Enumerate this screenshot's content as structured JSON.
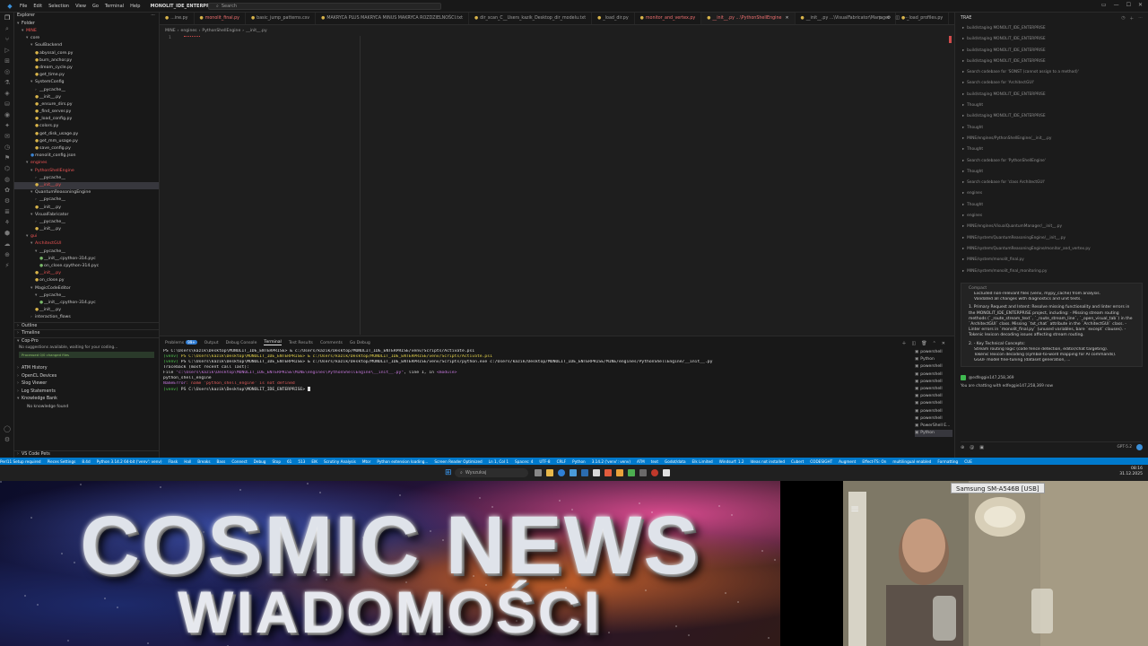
{
  "titlebar": {
    "menus": [
      "File",
      "Edit",
      "Selection",
      "View",
      "Go",
      "Terminal",
      "Help"
    ],
    "workspace": "MONOLIT_IDE_ENTERPRISE",
    "search_placeholder": "Search"
  },
  "explorer": {
    "title": "Explorer",
    "folder_label": "Folder",
    "items": [
      {
        "label": "MINE",
        "indent": 1,
        "chev": "▾",
        "red": true
      },
      {
        "label": "core",
        "indent": 2,
        "chev": "▾"
      },
      {
        "label": "SoulBackend",
        "indent": 3,
        "chev": "▾"
      },
      {
        "label": "abyssal_core.py",
        "indent": 4,
        "icon": "y"
      },
      {
        "label": "burn_anchor.py",
        "indent": 4,
        "icon": "y"
      },
      {
        "label": "dream_cycle.py",
        "indent": 4,
        "icon": "y"
      },
      {
        "label": "get_time.py",
        "indent": 4,
        "icon": "y"
      },
      {
        "label": "SystemConfig",
        "indent": 3,
        "chev": "▾"
      },
      {
        "label": "__pycache__",
        "indent": 4,
        "chev": "›"
      },
      {
        "label": "__init__.py",
        "indent": 4,
        "icon": "y"
      },
      {
        "label": "_ensure_dirs.py",
        "indent": 4,
        "icon": "y"
      },
      {
        "label": "_find_server.py",
        "indent": 4,
        "icon": "y"
      },
      {
        "label": "_load_config.py",
        "indent": 4,
        "icon": "y"
      },
      {
        "label": "colors.py",
        "indent": 4,
        "icon": "y"
      },
      {
        "label": "get_disk_usage.py",
        "indent": 4,
        "icon": "y"
      },
      {
        "label": "get_mm_usage.py",
        "indent": 4,
        "icon": "y"
      },
      {
        "label": "save_config.py",
        "indent": 4,
        "icon": "y"
      },
      {
        "label": "monolit_config.json",
        "indent": 3,
        "icon": "b"
      },
      {
        "label": "engines",
        "indent": 2,
        "chev": "▾",
        "red": true
      },
      {
        "label": "PythonShellEngine",
        "indent": 3,
        "chev": "▾",
        "red": true
      },
      {
        "label": "__pycache__",
        "indent": 4,
        "chev": "›"
      },
      {
        "label": "__init__.py",
        "indent": 4,
        "icon": "y",
        "red": true,
        "selected": true
      },
      {
        "label": "QuantumReasoningEngine",
        "indent": 3,
        "chev": "▾"
      },
      {
        "label": "__pycache__",
        "indent": 4,
        "chev": "›"
      },
      {
        "label": "__init__.py",
        "indent": 4,
        "icon": "y"
      },
      {
        "label": "VisualFabricator",
        "indent": 3,
        "chev": "▾"
      },
      {
        "label": "__pycache__",
        "indent": 4,
        "chev": "›"
      },
      {
        "label": "__init__.py",
        "indent": 4,
        "icon": "y"
      },
      {
        "label": "gui",
        "indent": 2,
        "chev": "▾",
        "red": true
      },
      {
        "label": "ArchitectGUI",
        "indent": 3,
        "chev": "▾",
        "red": true
      },
      {
        "label": "__pycache__",
        "indent": 4,
        "chev": "▾"
      },
      {
        "label": "__init__.cpython-314.pyc",
        "indent": 5,
        "icon": "g"
      },
      {
        "label": "on_close.cpython-314.pyc",
        "indent": 5,
        "icon": "g"
      },
      {
        "label": "__init__.py",
        "indent": 4,
        "icon": "y",
        "red": true
      },
      {
        "label": "on_close.py",
        "indent": 4,
        "icon": "y"
      },
      {
        "label": "MagicCodeEditor",
        "indent": 3,
        "chev": "▾"
      },
      {
        "label": "__pycache__",
        "indent": 4,
        "chev": "▾"
      },
      {
        "label": "__init__.cpython-314.pyc",
        "indent": 5,
        "icon": "g"
      },
      {
        "label": "__init__.py",
        "indent": 4,
        "icon": "y"
      },
      {
        "label": "interaction_flows",
        "indent": 3,
        "chev": "›"
      }
    ],
    "sections_top": [
      "Outline",
      "Timeline"
    ],
    "codepro": {
      "title": "Cop-Pro",
      "line1": "No suggestions available, waiting for your coding...",
      "line2": "Processed 0/0 changed files"
    },
    "sections_bottom": [
      "ATM History",
      "OpenCL Devices",
      "Slog Viewer",
      "Log Statements",
      "Knowledge Bank"
    ],
    "knowledge_empty": "No knowledge found",
    "footer": "VS Code Pets"
  },
  "tabs": [
    {
      "label": "...ine.py",
      "state": ""
    },
    {
      "label": "monolit_final.py",
      "state": "err"
    },
    {
      "label": "basic_jump_patterns.csv",
      "state": ""
    },
    {
      "label": "MAKRYCA PLUS MAKRYCA MINUS MAKRYCA ROZDZIELNOŚCI.txt",
      "state": ""
    },
    {
      "label": "dir_scan_C__Users_kazik_Desktop_dir_modelu.txt",
      "state": ""
    },
    {
      "label": "_load_dir.py",
      "state": ""
    },
    {
      "label": "monitor_and_vertex.py",
      "state": "err"
    },
    {
      "label": "__init__.py ...\\PythonShellEngine",
      "state": "active"
    },
    {
      "label": "__init__.py ...\\VisualFabricator\\Manager",
      "state": ""
    },
    {
      "label": "_load_profiles.py",
      "state": ""
    }
  ],
  "breadcrumb": [
    "MINE",
    "engines",
    "PythonShellEngine",
    "__init__.py"
  ],
  "editor": {
    "line_number": "1"
  },
  "panel": {
    "tabs": [
      "Problems",
      "Output",
      "Debug Console",
      "Terminal",
      "Test Results",
      "Comments",
      "Go Debug"
    ],
    "problems_count": "99+",
    "active_tab": "Terminal",
    "terminal_lines": [
      [
        {
          "t": "PS C:\\Users\\kazik\\Desktop\\MONOLIT_IDE_ENTERPRISE> & c:/Users/kazik/Desktop/MONOLIT_IDE_ENTERPRISE/venv/Scripts/Activate.ps1",
          "c": "c-white"
        }
      ],
      [
        {
          "t": "(venv) ",
          "c": "c-green"
        },
        {
          "t": "PS C:\\Users\\kazik\\Desktop\\MONOLIT_IDE_ENTERPRISE> & c:/Users/kazik/Desktop/MONOLIT_IDE_ENTERPRISE/venv/Scripts/Activate.ps1",
          "c": "c-yellow"
        }
      ],
      [
        {
          "t": "(venv) ",
          "c": "c-green"
        },
        {
          "t": "PS C:\\Users\\kazik\\Desktop\\MONOLIT_IDE_ENTERPRISE> & c:/Users/kazik/Desktop/MONOLIT_IDE_ENTERPRISE/venv/Scripts/python.exe c:/Users/kazik/Desktop/MONOLIT_IDE_ENTERPRISE/MINE/engines/PythonShellEngine/__init__.py",
          "c": "c-white"
        }
      ],
      [
        {
          "t": "Traceback (most recent call last):",
          "c": "c-white"
        }
      ],
      [
        {
          "t": "  File ",
          "c": "c-white"
        },
        {
          "t": "\"c:\\Users\\kazik\\Desktop\\MONOLIT_IDE_ENTERPRISE\\MINE\\engines\\PythonShellEngine\\__init__.py\"",
          "c": "c-mag"
        },
        {
          "t": ", line 1, in ",
          "c": "c-white"
        },
        {
          "t": "<module>",
          "c": "c-mag"
        }
      ],
      [
        {
          "t": "    python_shell_engine",
          "c": "c-white"
        }
      ],
      [
        {
          "t": "NameError",
          "c": "c-mag"
        },
        {
          "t": ": name 'python_shell_engine' is not defined",
          "c": "c-red"
        }
      ],
      [
        {
          "t": "(venv) ",
          "c": "c-green"
        },
        {
          "t": "PS C:\\Users\\kazik\\Desktop\\MONOLIT_IDE_ENTERPRISE> ",
          "c": "c-white"
        }
      ]
    ],
    "terminal_list": [
      "powershell",
      "Python",
      "powershell",
      "powershell",
      "powershell",
      "powershell",
      "powershell",
      "powershell",
      "powershell",
      "powershell",
      "PowerShell E...",
      "Python"
    ]
  },
  "copilot": {
    "title": "TRAE",
    "history": [
      "build/staging MONOLIT_IDE_ENTERPRISE",
      "build/staging MONOLIT_IDE_ENTERPRISE",
      "build/staging MONOLIT_IDE_ENTERPRISE",
      "build/staging MONOLIT_IDE_ENTERPRISE",
      "Search codebase for 'SONST (cannot assign to a method)'",
      "Search codebase for 'ArchitectGUI'",
      "build/staging MONOLIT_IDE_ENTERPRISE",
      "Thought",
      "build/staging MONOLIT_IDE_ENTERPRISE",
      "Thought",
      "MINE/engines/PythonShellEngine/__init__.py",
      "Thought",
      "Search codebase for 'PythonShellEngine'",
      "Thought",
      "Search codebase for 'class ArchitectGUI'",
      "engines",
      "Thought",
      "engines",
      "MINE/engines/VisualQuantumManager/__init__.py",
      "MINE/system/QuantumReasoningEngine/__init__.py",
      "MINE/system/QuantumReasoningEngine/monitor_and_vertex.py",
      "MINE/system/monolit_final.py",
      "MINE/system/monolit_final_monitoring.py"
    ],
    "summary_head": "Compact",
    "summary_bullets": [
      "Excluded non-relevant files (venv, mypy_cache) from analysis.",
      "Validated all changes with diagnostics and unit tests."
    ],
    "para1": "1. Primary Request and Intent: Resolve missing functionality and linter errors in the MONOLIT_IDE_ENTERPRISE project, including: - Missing stream routing methods (`_route_stream_text`, `_route_stream_line`, `_open_visual_tab`) in the `ArchitectGUI` class. Missing `txt_chat` attribute in the `ArchitectGUI` class. - Linter errors in `monolit_final.py` (unused variables, bare `except` clauses). - Tokenic lexicon decoding issues affecting stream routing.",
    "para2": "2. - Key Technical Concepts:",
    "bullets2": [
      "Stream routing logic (code fence detection, editor/chat targeting).",
      "Tokenic lexicon decoding (symbol-to-word mapping for AI commands).",
      "GGUF model fine-tuning (dataset generation, ..."
    ],
    "user": "@edfeggie147,258,369",
    "chat_line": "You are chatting with edfeggie147,258,369 now",
    "model": "GPT-5.2"
  },
  "statusbar": [
    "Perl11 Setup required",
    "Pieces Settings",
    "8.4d",
    "Python 3.14.2 64-bit ('venv': venv)",
    "Flask",
    "Hall",
    "Breaks",
    "Bass",
    "Connect",
    "Debug",
    "Stop",
    "61",
    "513",
    "EIK",
    "Scrutiny Analysis",
    "Mtor",
    "Python extension loading...",
    "Screen Reader Optimized",
    "Ln 1, Col 1",
    "Spaces: 4",
    "UTF-8",
    "CRLF",
    "Python",
    "3.14.2 ('venv': venv)",
    "ATM",
    "text",
    "Godot/data",
    "Elk Limited",
    "Windsurf: 1.2",
    "Ideas not installed",
    "Cubert",
    "CODESIGHT",
    "Augment",
    "Effect-TS: On",
    "multilingual enabled",
    "Formatting",
    "CUE"
  ],
  "taskbar": {
    "search_placeholder": "Wyszukaj",
    "time": "08:16",
    "date": "31.12.2025"
  },
  "overlay": {
    "title": "COSMIC NEWS",
    "subtitle": "WIADOMOŚCI",
    "camera_label": "Samsung SM-A546B [USB]"
  }
}
